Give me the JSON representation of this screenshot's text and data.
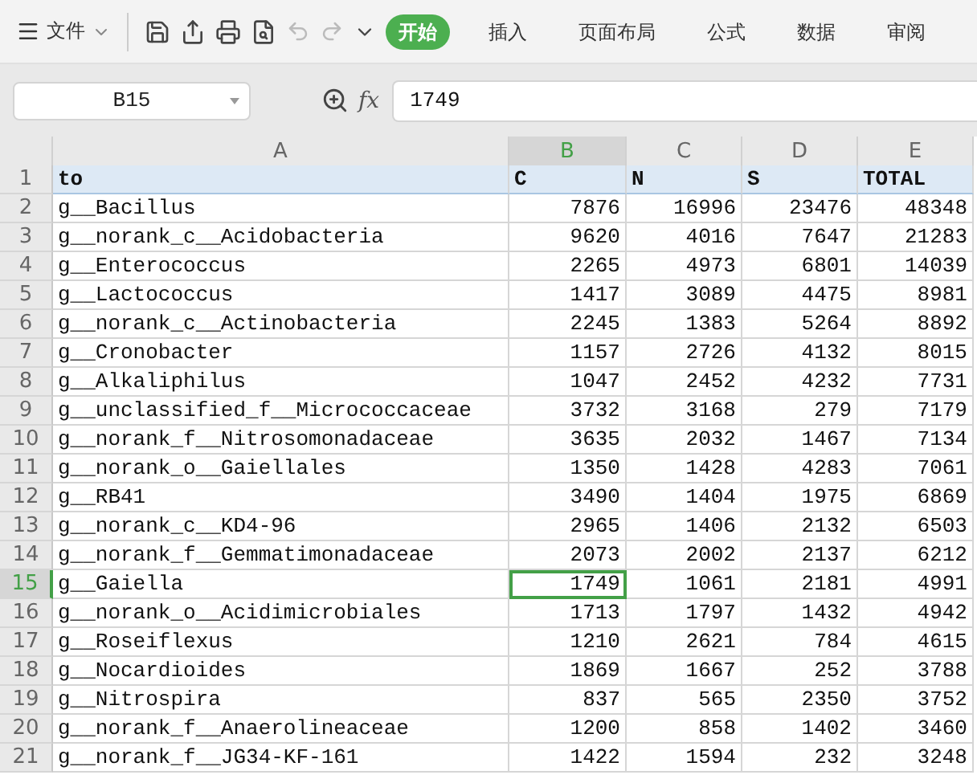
{
  "toolbar": {
    "menu_label": "文件",
    "tabs": [
      {
        "label": "开始",
        "selected": true
      },
      {
        "label": "插入",
        "selected": false
      },
      {
        "label": "页面布局",
        "selected": false
      },
      {
        "label": "公式",
        "selected": false
      },
      {
        "label": "数据",
        "selected": false
      },
      {
        "label": "审阅",
        "selected": false
      }
    ]
  },
  "formula_bar": {
    "name_box": "B15",
    "fx_label": "fx",
    "formula": "1749"
  },
  "columns": [
    {
      "label": "A",
      "selected": false
    },
    {
      "label": "B",
      "selected": true
    },
    {
      "label": "C",
      "selected": false
    },
    {
      "label": "D",
      "selected": false
    },
    {
      "label": "E",
      "selected": false
    }
  ],
  "rows": [
    {
      "number": "1",
      "kind": "header",
      "selected": false,
      "cells": [
        "to",
        "C",
        "N",
        "S",
        "TOTAL"
      ]
    },
    {
      "number": "2",
      "kind": "data",
      "selected": false,
      "cells": [
        "g__Bacillus",
        "7876",
        "16996",
        "23476",
        "48348"
      ]
    },
    {
      "number": "3",
      "kind": "data",
      "selected": false,
      "cells": [
        "g__norank_c__Acidobacteria",
        "9620",
        "4016",
        "7647",
        "21283"
      ]
    },
    {
      "number": "4",
      "kind": "data",
      "selected": false,
      "cells": [
        "g__Enterococcus",
        "2265",
        "4973",
        "6801",
        "14039"
      ]
    },
    {
      "number": "5",
      "kind": "data",
      "selected": false,
      "cells": [
        "g__Lactococcus",
        "1417",
        "3089",
        "4475",
        "8981"
      ]
    },
    {
      "number": "6",
      "kind": "data",
      "selected": false,
      "cells": [
        "g__norank_c__Actinobacteria",
        "2245",
        "1383",
        "5264",
        "8892"
      ]
    },
    {
      "number": "7",
      "kind": "data",
      "selected": false,
      "cells": [
        "g__Cronobacter",
        "1157",
        "2726",
        "4132",
        "8015"
      ]
    },
    {
      "number": "8",
      "kind": "data",
      "selected": false,
      "cells": [
        "g__Alkaliphilus",
        "1047",
        "2452",
        "4232",
        "7731"
      ]
    },
    {
      "number": "9",
      "kind": "data",
      "selected": false,
      "cells": [
        "g__unclassified_f__Micrococcaceae",
        "3732",
        "3168",
        "279",
        "7179"
      ]
    },
    {
      "number": "10",
      "kind": "data",
      "selected": false,
      "cells": [
        "g__norank_f__Nitrosomonadaceae",
        "3635",
        "2032",
        "1467",
        "7134"
      ]
    },
    {
      "number": "11",
      "kind": "data",
      "selected": false,
      "cells": [
        "g__norank_o__Gaiellales",
        "1350",
        "1428",
        "4283",
        "7061"
      ]
    },
    {
      "number": "12",
      "kind": "data",
      "selected": false,
      "cells": [
        "g__RB41",
        "3490",
        "1404",
        "1975",
        "6869"
      ]
    },
    {
      "number": "13",
      "kind": "data",
      "selected": false,
      "cells": [
        "g__norank_c__KD4-96",
        "2965",
        "1406",
        "2132",
        "6503"
      ]
    },
    {
      "number": "14",
      "kind": "data",
      "selected": false,
      "cells": [
        "g__norank_f__Gemmatimonadaceae",
        "2073",
        "2002",
        "2137",
        "6212"
      ]
    },
    {
      "number": "15",
      "kind": "data",
      "selected": true,
      "cells": [
        "g__Gaiella",
        "1749",
        "1061",
        "2181",
        "4991"
      ]
    },
    {
      "number": "16",
      "kind": "data",
      "selected": false,
      "cells": [
        "g__norank_o__Acidimicrobiales",
        "1713",
        "1797",
        "1432",
        "4942"
      ]
    },
    {
      "number": "17",
      "kind": "data",
      "selected": false,
      "cells": [
        "g__Roseiflexus",
        "1210",
        "2621",
        "784",
        "4615"
      ]
    },
    {
      "number": "18",
      "kind": "data",
      "selected": false,
      "cells": [
        "g__Nocardioides",
        "1869",
        "1667",
        "252",
        "3788"
      ]
    },
    {
      "number": "19",
      "kind": "data",
      "selected": false,
      "cells": [
        "g__Nitrospira",
        "837",
        "565",
        "2350",
        "3752"
      ]
    },
    {
      "number": "20",
      "kind": "data",
      "selected": false,
      "cells": [
        "g__norank_f__Anaerolineaceae",
        "1200",
        "858",
        "1402",
        "3460"
      ]
    },
    {
      "number": "21",
      "kind": "data",
      "selected": false,
      "cells": [
        "g__norank_f__JG34-KF-161",
        "1422",
        "1594",
        "232",
        "3248"
      ]
    }
  ]
}
